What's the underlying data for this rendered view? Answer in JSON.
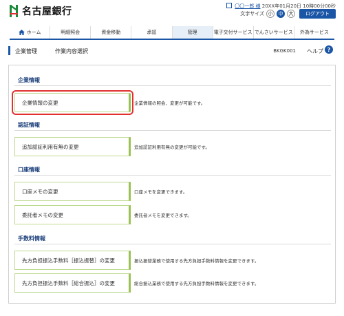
{
  "brand": {
    "name": "名古屋銀行"
  },
  "user": {
    "name": "〇〇一郎 様",
    "last_login": "20XX年01月20日 10時00分00秒"
  },
  "font_size": {
    "label": "文字サイズ",
    "small": "小",
    "medium": "中",
    "large": "大",
    "selected": "中"
  },
  "logout_label": "ログアウト",
  "nav": {
    "items": [
      {
        "label": "ホーム",
        "icon": "home-icon"
      },
      {
        "label": "明細照会"
      },
      {
        "label": "資金移動"
      },
      {
        "label": "承認"
      },
      {
        "label": "管理",
        "active": true
      },
      {
        "label": "電子交付サービス"
      },
      {
        "label": "でんさいサービス"
      },
      {
        "label": "外為サービス"
      }
    ]
  },
  "title": {
    "category": "企業管理",
    "page": "作業内容選択",
    "code": "BKGK001",
    "help": "ヘルプ",
    "help_icon": "?"
  },
  "sections": [
    {
      "title": "企業情報",
      "items": [
        {
          "label": "企業情報の変更",
          "desc": "企業情報の照会、変更が可能です。"
        }
      ]
    },
    {
      "title": "認証情報",
      "items": [
        {
          "label": "追加認証利用有無の変更",
          "desc": "追加認証利用有無の変更が可能です。"
        }
      ]
    },
    {
      "title": "口座情報",
      "items": [
        {
          "label": "口座メモの変更",
          "desc": "口座メモを変更できます。"
        },
        {
          "label": "委託者メモの変更",
          "desc": "委託者メモを変更できます。"
        }
      ]
    },
    {
      "title": "手数料情報",
      "items": [
        {
          "label": "先方負担振込手数料［振込振替］の変更",
          "desc": "振込振替業務で使用する先方負担手数料情報を変更できます。"
        },
        {
          "label": "先方負担振込手数料［総合振込］の変更",
          "desc": "総合振込業務で使用する先方負担手数料情報を変更できます。"
        }
      ]
    }
  ],
  "colors": {
    "accent": "#1b56a6",
    "logo_green": "#1a8a3a",
    "button_border": "#9bc153",
    "highlight": "#e23030"
  }
}
